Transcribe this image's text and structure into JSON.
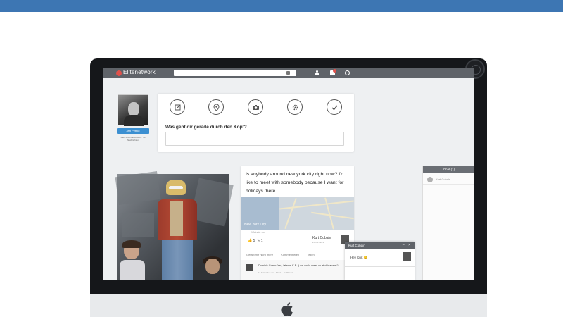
{
  "app": {
    "name": "Elitenetwork"
  },
  "colors": {
    "brand_blue": "#3d76b3",
    "nav": "#5f6369",
    "logo_red": "#e0514b",
    "accent_blue": "#3b8fd1"
  },
  "profile": {
    "button_label": "Jan Pettko",
    "subtitle": "Dein Profil bearbeiten · 38 Nachrichten"
  },
  "status": {
    "actions": [
      "edit-icon",
      "location-icon",
      "camera-icon",
      "settings-icon",
      "check-icon"
    ],
    "question": "Was geht dir gerade durch den Kopf?",
    "placeholder": ""
  },
  "post": {
    "text": "Is anybody around new york city right now? I'd like to meet with somebody because I want for holidays there.",
    "map_label": "New York City",
    "time": "1 Minute vor",
    "likes": "5",
    "comments_count": "1",
    "author": "Kurt Cobain",
    "author_sub": "Zum Profil »",
    "actions": [
      "Gefällt mir nicht mehr",
      "Kommentieren",
      "Teilen"
    ],
    "comment": {
      "text": "Dominik Gores: Yes, later at K.P. :) we could meet up at chinatown?",
      "meta": "11 Sekunden vor · Melde · Gefällt mir"
    }
  },
  "chat": {
    "title": "Chat (1)",
    "contacts": [
      {
        "name": "Kurt Cobain"
      }
    ]
  },
  "chat_popup": {
    "name": "Kurt Cobain",
    "controls": "– ×",
    "message": "Hey Kurt 😊"
  }
}
